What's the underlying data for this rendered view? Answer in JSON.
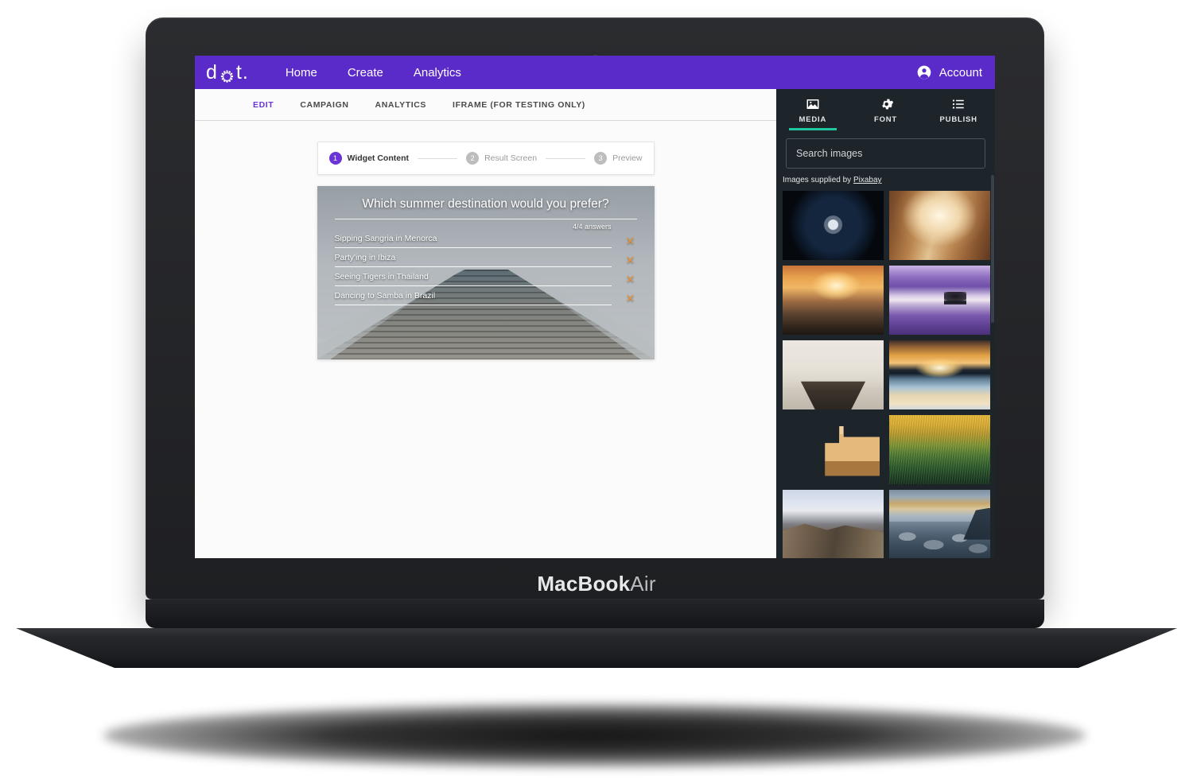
{
  "device": {
    "label_bold": "MacBook",
    "label_light": "Air",
    "camera_icon": "camera-dot-icon"
  },
  "topnav": {
    "brand_d": "d",
    "brand_o_icon": "dotted-circle-logo-icon",
    "brand_t": "t.",
    "links": [
      {
        "label": "Home"
      },
      {
        "label": "Create"
      },
      {
        "label": "Analytics"
      }
    ],
    "account": {
      "label": "Account",
      "icon": "account-person-icon"
    },
    "accent_color": "#5B2BC9"
  },
  "subtabs": {
    "items": [
      {
        "label": "EDIT",
        "active": true
      },
      {
        "label": "CAMPAIGN",
        "active": false
      },
      {
        "label": "ANALYTICS",
        "active": false
      },
      {
        "label": "IFRAME (FOR TESTING ONLY)",
        "active": false
      }
    ],
    "active_color": "#6b34d6"
  },
  "stepper": {
    "steps": [
      {
        "num": "1",
        "label": "Widget Content",
        "active": true
      },
      {
        "num": "2",
        "label": "Result Screen",
        "active": false
      },
      {
        "num": "3",
        "label": "Preview",
        "active": false
      }
    ]
  },
  "widget": {
    "question": "Which summer destination would you prefer?",
    "answers_count": "4/4 answers",
    "remove_icon": "close-x-icon",
    "remove_color": "#e8933f",
    "answers": [
      {
        "text": "Sipping Sangria in Menorca"
      },
      {
        "text": "Party'ing in Ibiza"
      },
      {
        "text": "Seeing Tigers in Thailand"
      },
      {
        "text": "Dancing to Samba in Brazil"
      }
    ],
    "background_description": "wooden-pier-to-sea-photo"
  },
  "sidebar": {
    "background_color": "#1d242a",
    "active_underline_color": "#1fc8a0",
    "tabs": [
      {
        "label": "MEDIA",
        "icon": "image-icon",
        "active": true
      },
      {
        "label": "FONT",
        "icon": "gear-icon",
        "active": false
      },
      {
        "label": "PUBLISH",
        "icon": "list-icon",
        "active": false
      }
    ],
    "search": {
      "placeholder": "Search images",
      "value": ""
    },
    "credit": {
      "prefix": "Images supplied by ",
      "link_label": "Pixabay"
    },
    "images": [
      {
        "name": "full-moon-night-sky",
        "art": "art-moon"
      },
      {
        "name": "canyon-light-beam",
        "art": "art-canyon"
      },
      {
        "name": "city-skyline-sunset",
        "art": "art-city"
      },
      {
        "name": "lone-tree-purple-lake",
        "art": "art-purple"
      },
      {
        "name": "wooden-dock-misty-lake",
        "art": "art-pier"
      },
      {
        "name": "golden-sunset-over-water",
        "art": "art-sunset"
      },
      {
        "name": "coastal-town-cliffside",
        "art": "art-town"
      },
      {
        "name": "golden-forest-field",
        "art": "art-field"
      },
      {
        "name": "mountain-valley-road",
        "art": "art-valley"
      },
      {
        "name": "rocky-shore-twilight",
        "art": "art-rocks"
      }
    ]
  }
}
